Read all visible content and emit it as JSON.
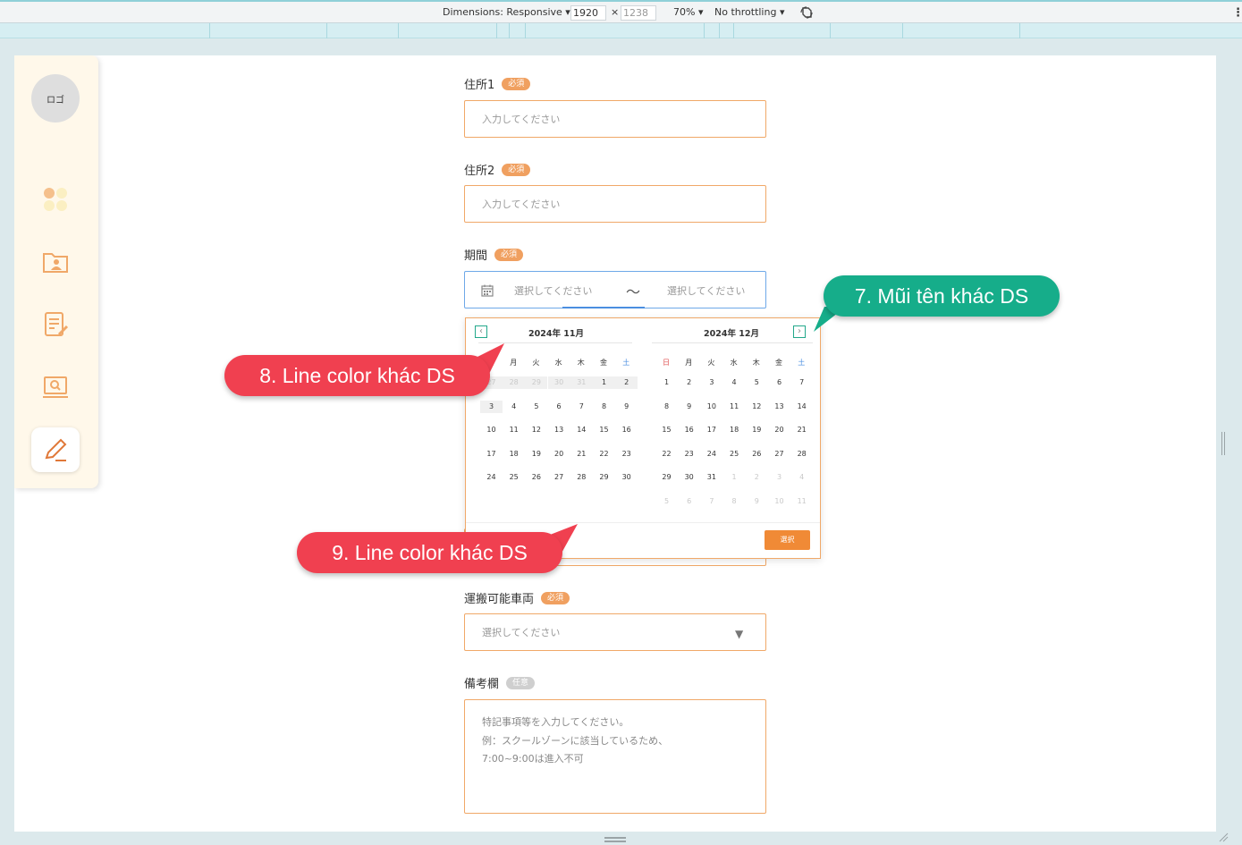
{
  "devtools": {
    "dimensions_label": "Dimensions: Responsive ▾",
    "width": "1920",
    "times": "×",
    "height": "1238",
    "zoom": "70% ▾",
    "throttling": "No throttling ▾",
    "more": "⋮"
  },
  "sidebar": {
    "logo": "ロゴ",
    "icons": [
      "dashboard-icon",
      "folder-user-icon",
      "document-edit-icon",
      "monitor-search-icon",
      "pen-icon"
    ]
  },
  "form": {
    "address1": {
      "label": "住所1",
      "badge": "必須",
      "placeholder": "入力してください"
    },
    "address2": {
      "label": "住所2",
      "badge": "必須",
      "placeholder": "入力してください"
    },
    "period": {
      "label": "期間",
      "badge": "必須",
      "start_placeholder": "選択してください",
      "separator": "〜",
      "end_placeholder": "選択してください"
    },
    "vehicle": {
      "label": "運搬可能車両",
      "badge": "必須",
      "placeholder": "選択してください",
      "arrow": "▼"
    },
    "remarks": {
      "label": "備考欄",
      "badge": "任意",
      "placeholder_lines": [
        "特記事項等を入力してください。",
        "例：スクールゾーンに該当しているため、",
        "7:00~9:00は進入不可"
      ]
    }
  },
  "calendar": {
    "prev": "‹",
    "next": "›",
    "left_title": "2024年  11月",
    "right_title": "2024年  12月",
    "weekdays": [
      "日",
      "月",
      "火",
      "水",
      "木",
      "金",
      "土"
    ],
    "left_days": [
      [
        "27",
        "28",
        "29",
        "30",
        "31",
        "1",
        "2"
      ],
      [
        "3",
        "4",
        "5",
        "6",
        "7",
        "8",
        "9"
      ],
      [
        "10",
        "11",
        "12",
        "13",
        "14",
        "15",
        "16"
      ],
      [
        "17",
        "18",
        "19",
        "20",
        "21",
        "22",
        "23"
      ],
      [
        "24",
        "25",
        "26",
        "27",
        "28",
        "29",
        "30"
      ]
    ],
    "right_days": [
      [
        "1",
        "2",
        "3",
        "4",
        "5",
        "6",
        "7"
      ],
      [
        "8",
        "9",
        "10",
        "11",
        "12",
        "13",
        "14"
      ],
      [
        "15",
        "16",
        "17",
        "18",
        "19",
        "20",
        "21"
      ],
      [
        "22",
        "23",
        "24",
        "25",
        "26",
        "27",
        "28"
      ],
      [
        "29",
        "30",
        "31",
        "1",
        "2",
        "3",
        "4"
      ],
      [
        "5",
        "6",
        "7",
        "8",
        "9",
        "10",
        "11"
      ]
    ],
    "select_button": "選択"
  },
  "annotations": {
    "a7": "7. Mũi tên khác DS",
    "a8": "8. Line color khác DS",
    "a9": "9. Line color khác DS"
  },
  "colors": {
    "accent": "#f08a36",
    "callout_red": "#f04050",
    "callout_green": "#16ad8a",
    "sidebar_bg": "#fff8ea"
  }
}
